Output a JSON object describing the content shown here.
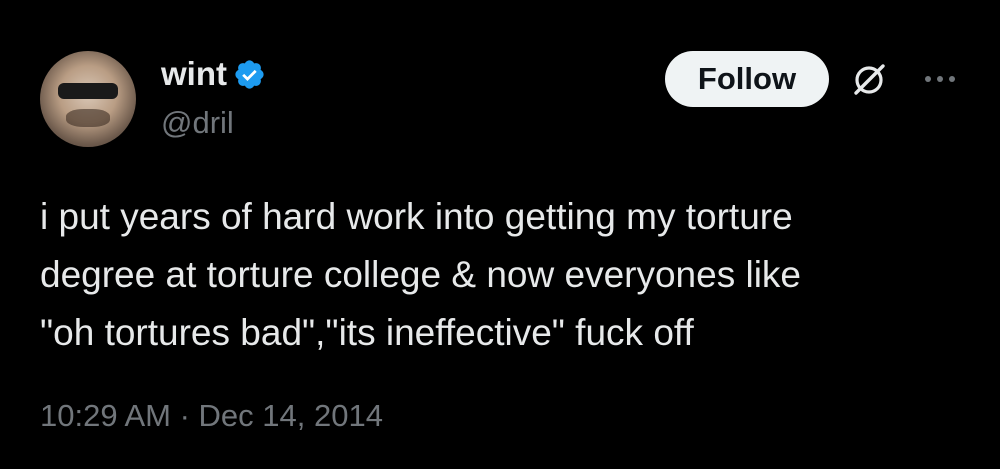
{
  "author": {
    "display_name": "wint",
    "handle": "@dril",
    "verified": true,
    "verified_color": "#1d9bf0"
  },
  "actions": {
    "follow_label": "Follow",
    "grok_icon": "grok-icon",
    "more_icon": "more-options-icon"
  },
  "tweet": {
    "text": "i put years of hard work into getting my torture\ndegree at torture college & now everyones like\n\"oh tortures bad\",\"its ineffective\" fuck off",
    "timestamp": "10:29 AM · Dec 14, 2014"
  },
  "colors": {
    "background": "#000000",
    "primary_text": "#e7e9ea",
    "secondary_text": "#71767b",
    "button_bg": "#eff3f4"
  }
}
